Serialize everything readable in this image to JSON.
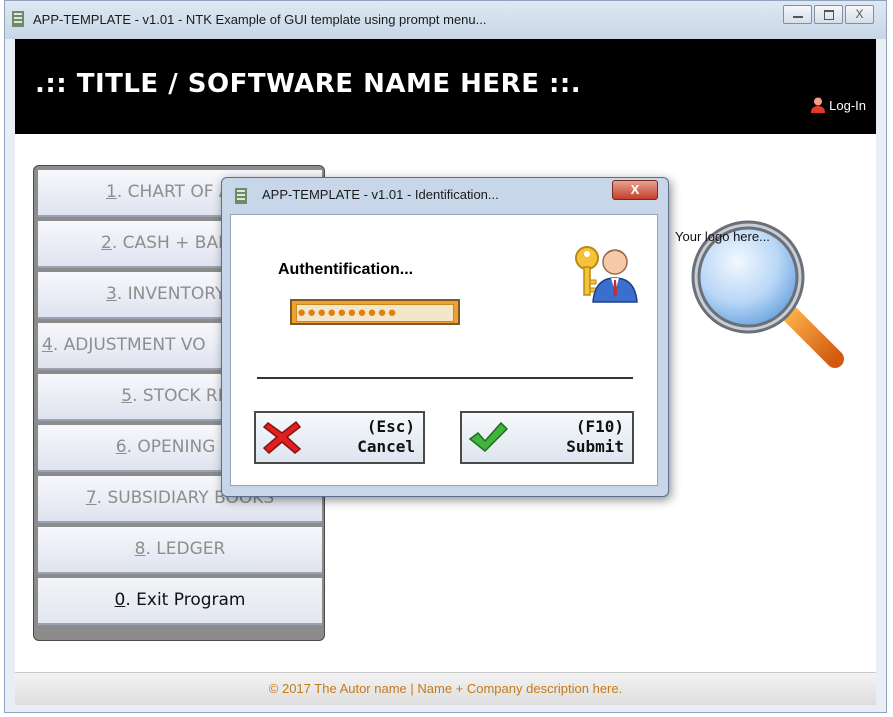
{
  "window": {
    "title": "APP-TEMPLATE - v1.01 -  NTK Example of GUI template using prompt menu...",
    "controls": {
      "minimize": "",
      "maximize": "",
      "close": "X"
    }
  },
  "header": {
    "app_title": ".:: TITLE / SOFTWARE NAME HERE ::.",
    "login_label": "Log-In"
  },
  "menu": {
    "items": [
      {
        "hotkey": "1",
        "rest": ". CHART OF ACC",
        "active": false
      },
      {
        "hotkey": "2",
        "rest": ". CASH + BANK A",
        "active": false
      },
      {
        "hotkey": "3",
        "rest": ". INVENTORY AC",
        "active": false
      },
      {
        "hotkey": "4",
        "rest": ". ADJUSTMENT VO",
        "active": false
      },
      {
        "hotkey": "5",
        "rest": ". STOCK REP",
        "active": false
      },
      {
        "hotkey": "6",
        "rest": ". OPENING EN",
        "active": false
      },
      {
        "hotkey": "7",
        "rest": ". SUBSIDIARY BOOKS",
        "active": false
      },
      {
        "hotkey": "8",
        "rest": ". LEDGER",
        "active": false
      },
      {
        "hotkey": "0",
        "rest": ". Exit Program",
        "active": true
      }
    ]
  },
  "logo": {
    "text": "Your logo here..."
  },
  "footer": {
    "text": "© 2017  The Autor name   |   Name + Company description here."
  },
  "dialog": {
    "title": "APP-TEMPLATE - v1.01 - Identification...",
    "close_label": "X",
    "auth_label": "Authentification...",
    "password_value": "●●●●●●●●●●",
    "cancel": {
      "hotkey": "(Esc)",
      "label": "Cancel"
    },
    "submit": {
      "hotkey": "(F10)",
      "label": "Submit"
    }
  },
  "colors": {
    "header_bg": "#000000",
    "footer_text": "#c47a1c",
    "password_field": "#f0a030",
    "dialog_close": "#c2402b"
  },
  "icons": {
    "app": "app-icon",
    "login": "user-icon",
    "dialog_badge": "key-user-icon",
    "cancel": "red-x-icon",
    "submit": "green-check-icon",
    "logo": "magnifier-icon"
  }
}
